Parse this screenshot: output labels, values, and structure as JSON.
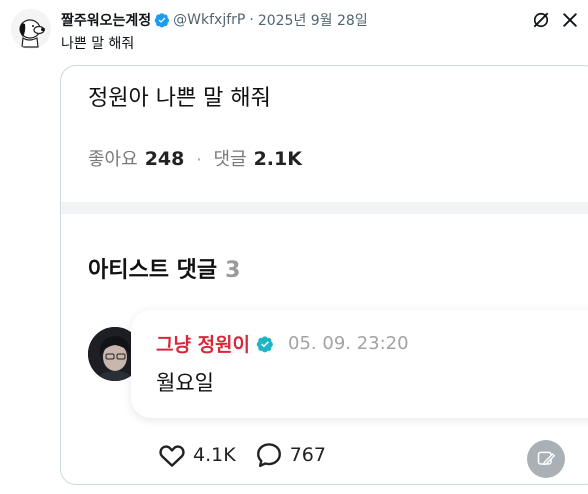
{
  "tweet": {
    "display_name": "짤주워오는계정",
    "handle": "@WkfxjfrP",
    "separator": "·",
    "date": "2025년 9월 28일",
    "text": "나쁜 말 해줘"
  },
  "icons": {
    "verified": "verified-badge-icon",
    "grok": "grok-icon",
    "more": "more-options-icon",
    "heart": "heart-icon",
    "comment": "comment-bubble-icon",
    "alt_image": "image-alt-icon"
  },
  "card": {
    "post_title": "정원아 나쁜 말 해줘",
    "likes_label": "좋아요",
    "likes_value": "248",
    "stat_separator": "·",
    "comments_label": "댓글",
    "comments_value": "2.1K",
    "section_label": "아티스트 댓글",
    "section_count": "3",
    "comment": {
      "author": "그냥 정원이",
      "time": "05. 09. 23:20",
      "text": "월요일"
    },
    "like_count": "4.1K",
    "reply_count": "767"
  },
  "colors": {
    "artist_name": "#d8283a",
    "verified_blue": "#1d9bf0",
    "badge_teal": "#1fb5c6",
    "muted": "#536471"
  }
}
